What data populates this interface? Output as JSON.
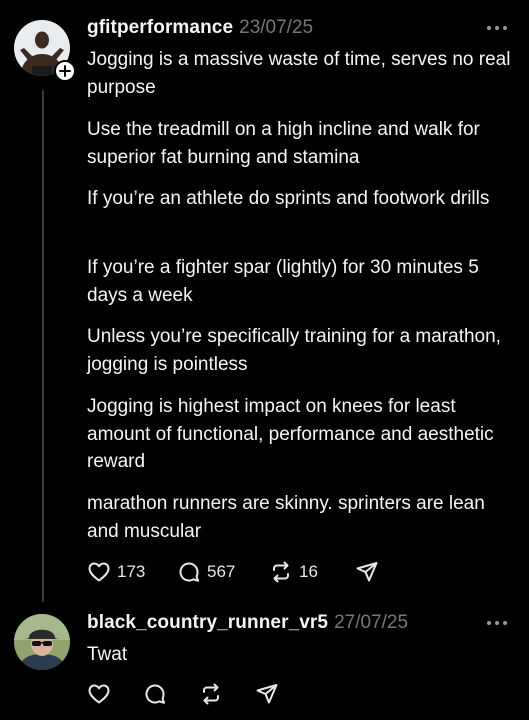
{
  "post": {
    "username": "gfitperformance",
    "date": "23/07/25",
    "paragraphs": [
      "Jogging is a massive waste of time, serves no real purpose",
      "Use the treadmill on a high incline and walk for superior fat burning and stamina",
      "If you’re an athlete do sprints and footwork drills",
      "If you’re a fighter spar (lightly) for 30 minutes 5 days a week",
      "Unless you’re specifically training for a marathon, jogging is pointless",
      "Jogging is highest impact on knees for least amount of functional, performance and aesthetic reward",
      "marathon runners are skinny. sprinters are lean and muscular"
    ],
    "likes": "173",
    "comments": "567",
    "reposts": "16"
  },
  "reply": {
    "username": "black_country_runner_vr5",
    "date": "27/07/25",
    "text": "Twat"
  },
  "icons": [
    "heart-icon",
    "comment-icon",
    "repost-icon",
    "share-icon",
    "more-icon",
    "plus-icon"
  ]
}
